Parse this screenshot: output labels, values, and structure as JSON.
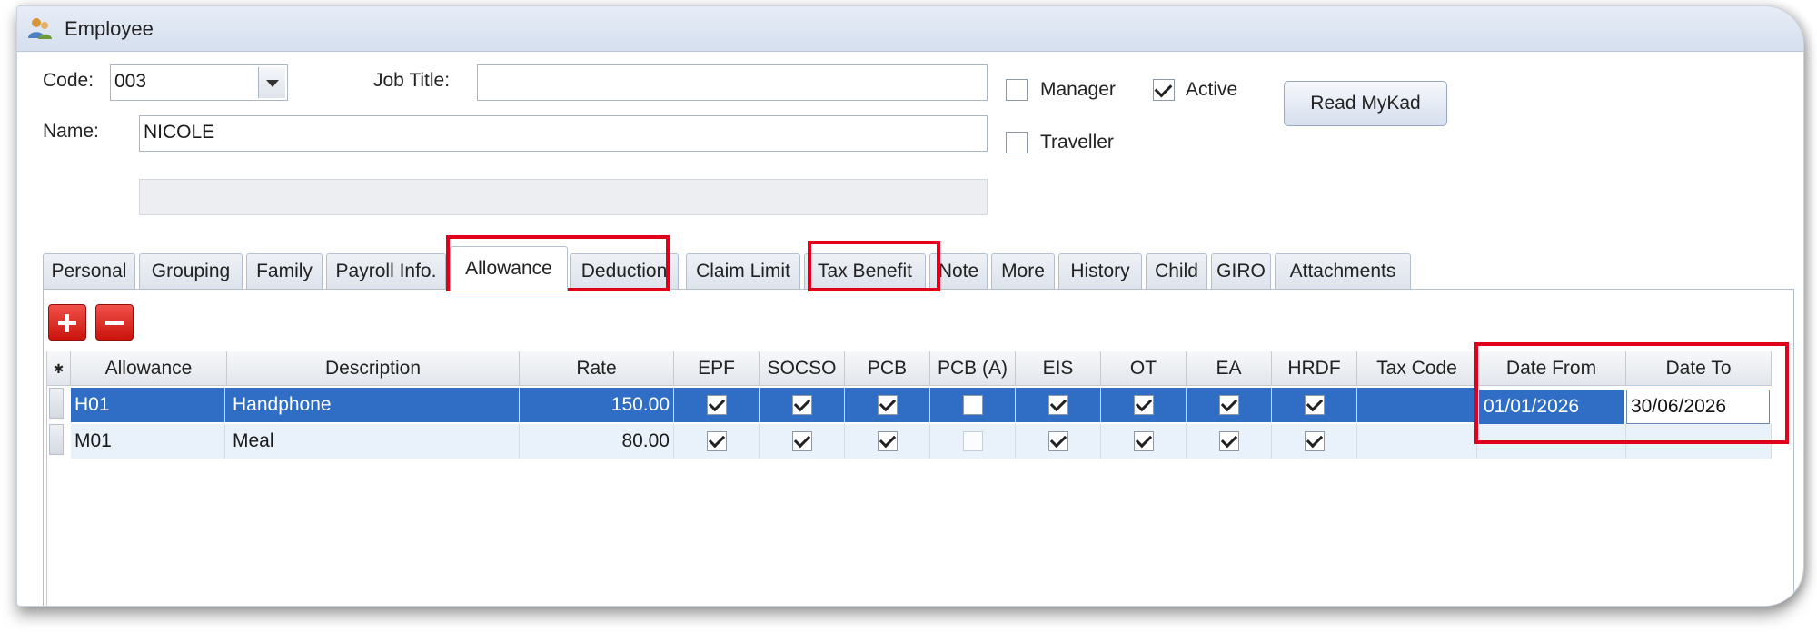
{
  "window": {
    "title": "Employee",
    "icon": "people-icon"
  },
  "header_form": {
    "code_label": "Code:",
    "code_value": "003",
    "job_title_label": "Job Title:",
    "job_title_value": "",
    "name_label": "Name:",
    "name_value": "NICOLE",
    "manager_label": "Manager",
    "manager_checked": false,
    "active_label": "Active",
    "active_checked": true,
    "traveller_label": "Traveller",
    "traveller_checked": false,
    "read_mykad_label": "Read MyKad"
  },
  "tabs": [
    {
      "label": "Personal"
    },
    {
      "label": "Grouping"
    },
    {
      "label": "Family"
    },
    {
      "label": "Payroll Info."
    },
    {
      "label": "Allowance",
      "active": true
    },
    {
      "label": "Deduction"
    },
    {
      "label": "Claim Limit"
    },
    {
      "label": "Tax Benefit"
    },
    {
      "label": "Note"
    },
    {
      "label": "More"
    },
    {
      "label": "History"
    },
    {
      "label": "Child"
    },
    {
      "label": "GIRO"
    },
    {
      "label": "Attachments"
    }
  ],
  "toolbar": {
    "add_icon": "plus-icon",
    "remove_icon": "minus-icon"
  },
  "grid": {
    "columns": [
      "Allowance",
      "Description",
      "Rate",
      "EPF",
      "SOCSO",
      "PCB",
      "PCB (A)",
      "EIS",
      "OT",
      "EA",
      "HRDF",
      "Tax Code",
      "Date From",
      "Date To"
    ],
    "rows": [
      {
        "allowance": "H01",
        "description": "Handphone",
        "rate": "150.00",
        "epf": true,
        "socso": true,
        "pcb": true,
        "pcb_a": false,
        "eis": true,
        "ot": true,
        "ea": true,
        "hrdf": true,
        "tax_code": "",
        "date_from": "01/01/2026",
        "date_to": "30/06/2026",
        "selected": true
      },
      {
        "allowance": "M01",
        "description": "Meal",
        "rate": "80.00",
        "epf": true,
        "socso": true,
        "pcb": true,
        "pcb_a": false,
        "eis": true,
        "ot": true,
        "ea": true,
        "hrdf": true,
        "tax_code": "",
        "date_from": "",
        "date_to": "",
        "selected": false
      }
    ]
  },
  "highlight_color": "#e0001b",
  "selection_color": "#2f6ec4"
}
